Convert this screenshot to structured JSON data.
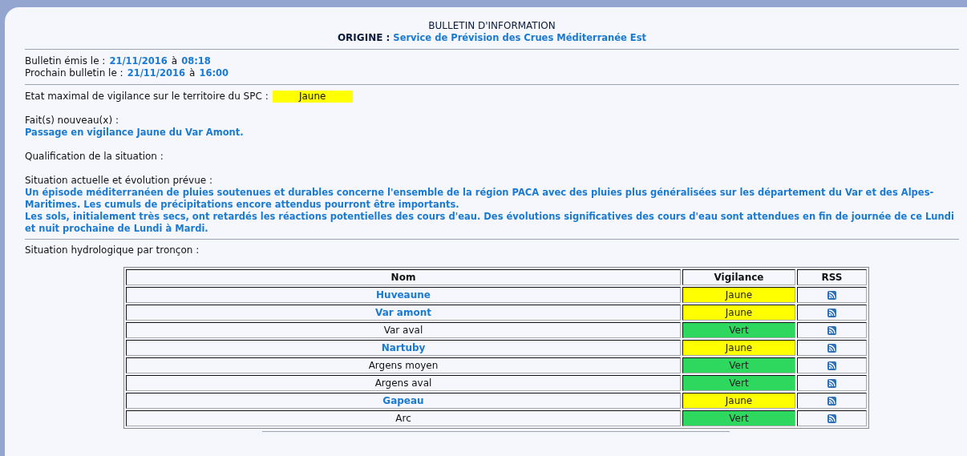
{
  "header": {
    "title": "BULLETIN D'INFORMATION",
    "origin_label": "ORIGINE :",
    "origin": "Service de Prévision des Crues Méditerranée Est"
  },
  "issued": {
    "label": "Bulletin émis le :",
    "date": "21/11/2016",
    "sep": "à",
    "time": "08:18"
  },
  "next": {
    "label": "Prochain bulletin le :",
    "date": "21/11/2016",
    "sep": "à",
    "time": "16:00"
  },
  "max_state": {
    "label": "Etat maximal de vigilance sur le territoire du SPC :",
    "value": "Jaune",
    "color": "#ffff00"
  },
  "news": {
    "label": "Fait(s) nouveau(x) :",
    "text": "Passage en vigilance Jaune du Var Amont."
  },
  "qualification": {
    "label": "Qualification de la situation :"
  },
  "situation": {
    "label": "Situation actuelle et évolution prévue :",
    "paragraphs": [
      "Un épisode méditerranéen de pluies soutenues et durables concerne l'ensemble de la région PACA avec des pluies plus généralisées sur les département du Var et des Alpes-Maritimes. Les cumuls de précipitations encore attendus pourront être importants.",
      "Les sols, initialement très secs, ont retardés les réactions potentielles des cours d'eau. Des évolutions significatives des cours d'eau sont attendues en fin de journée de ce Lundi et nuit prochaine de Lundi à Mardi."
    ]
  },
  "hydro_label": "Situation hydrologique par tronçon :",
  "table": {
    "columns": [
      "Nom",
      "Vigilance",
      "RSS"
    ],
    "rows": [
      {
        "name": "Huveaune",
        "link": true,
        "vigilance": "Jaune",
        "color": "#ffff00"
      },
      {
        "name": "Var amont",
        "link": true,
        "vigilance": "Jaune",
        "color": "#ffff00"
      },
      {
        "name": "Var aval",
        "link": false,
        "vigilance": "Vert",
        "color": "#2ed85f"
      },
      {
        "name": "Nartuby",
        "link": true,
        "vigilance": "Jaune",
        "color": "#ffff00"
      },
      {
        "name": "Argens moyen",
        "link": false,
        "vigilance": "Vert",
        "color": "#2ed85f"
      },
      {
        "name": "Argens aval",
        "link": false,
        "vigilance": "Vert",
        "color": "#2ed85f"
      },
      {
        "name": "Gapeau",
        "link": true,
        "vigilance": "Jaune",
        "color": "#ffff00"
      },
      {
        "name": "Arc",
        "link": false,
        "vigilance": "Vert",
        "color": "#2ed85f"
      }
    ]
  }
}
